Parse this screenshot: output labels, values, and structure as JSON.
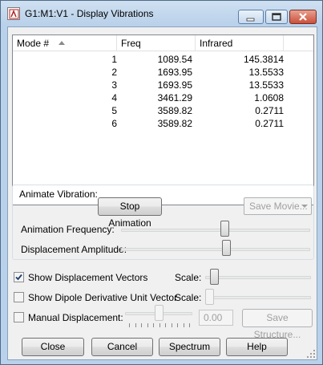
{
  "window": {
    "title": "G1:M1:V1 - Display Vibrations",
    "accent": "#b9d1ea"
  },
  "table": {
    "columns": [
      "Mode #",
      "Freq",
      "Infrared"
    ],
    "rows": [
      {
        "mode": "1",
        "freq": "1089.54",
        "ir": "145.3814"
      },
      {
        "mode": "2",
        "freq": "1693.95",
        "ir": "13.5533"
      },
      {
        "mode": "3",
        "freq": "1693.95",
        "ir": "13.5533"
      },
      {
        "mode": "4",
        "freq": "3461.29",
        "ir": "1.0608"
      },
      {
        "mode": "5",
        "freq": "3589.82",
        "ir": "0.2711"
      },
      {
        "mode": "6",
        "freq": "3589.82",
        "ir": "0.2711"
      }
    ]
  },
  "animate": {
    "group_label": "Animate Vibration:",
    "stop_label": "Stop Animation",
    "save_movie_label": "Save Movie...",
    "frequency_label": "Animation Frequency:",
    "frequency_level": 0.55,
    "amplitude_label": "Displacement Amplitude:",
    "amplitude_level": 0.56
  },
  "options": {
    "show_vectors_label": "Show Displacement Vectors",
    "show_vectors_checked": true,
    "vectors_scale_label": "Scale:",
    "vectors_scale_level": 0.05,
    "dipole_label": "Show Dipole Derivative Unit Vector",
    "dipole_checked": false,
    "dipole_scale_label": "Scale:",
    "dipole_scale_level": 0.0,
    "manual_label": "Manual Displacement:",
    "manual_checked": false,
    "manual_level": 0.5,
    "manual_value": "0.00",
    "save_structure_label": "Save Structure..."
  },
  "footer": {
    "close_label": "Close",
    "cancel_label": "Cancel",
    "spectrum_label": "Spectrum",
    "help_label": "Help"
  }
}
